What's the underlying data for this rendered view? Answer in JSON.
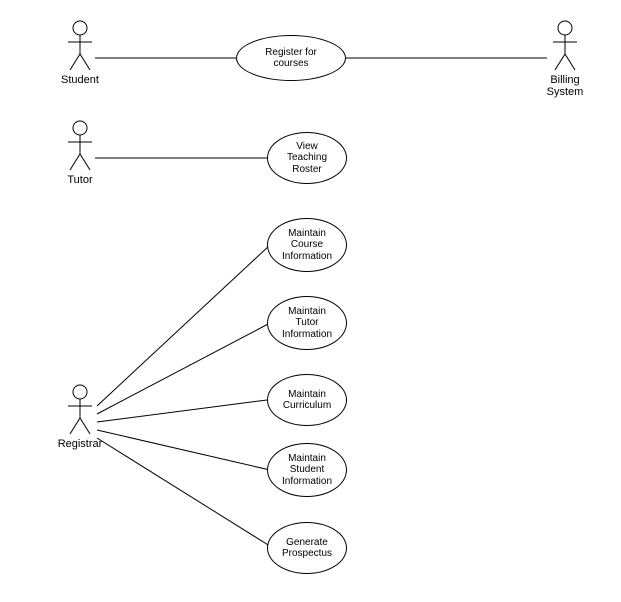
{
  "diagram_type": "UML Use Case Diagram",
  "actors": {
    "student": "Student",
    "billing": "Billing\nSystem",
    "tutor": "Tutor",
    "registrar": "Registrar"
  },
  "usecases": {
    "register": "Register for\ncourses",
    "view_roster": "View\nTeaching\nRoster",
    "maint_course": "Maintain\nCourse\nInformation",
    "maint_tutor": "Maintain\nTutor\nInformation",
    "maint_curriculum": "Maintain\nCurriculum",
    "maint_student": "Maintain\nStudent\nInformation",
    "gen_prospectus": "Generate\nProspectus"
  },
  "associations": [
    [
      "student",
      "register"
    ],
    [
      "billing",
      "register"
    ],
    [
      "tutor",
      "view_roster"
    ],
    [
      "registrar",
      "maint_course"
    ],
    [
      "registrar",
      "maint_tutor"
    ],
    [
      "registrar",
      "maint_curriculum"
    ],
    [
      "registrar",
      "maint_student"
    ],
    [
      "registrar",
      "gen_prospectus"
    ]
  ],
  "chart_data": {
    "type": "use-case-diagram",
    "actors": [
      "Student",
      "Billing System",
      "Tutor",
      "Registrar"
    ],
    "use_cases": [
      "Register for courses",
      "View Teaching Roster",
      "Maintain Course Information",
      "Maintain Tutor Information",
      "Maintain Curriculum",
      "Maintain Student Information",
      "Generate Prospectus"
    ],
    "links": [
      {
        "actor": "Student",
        "use_case": "Register for courses"
      },
      {
        "actor": "Billing System",
        "use_case": "Register for courses"
      },
      {
        "actor": "Tutor",
        "use_case": "View Teaching Roster"
      },
      {
        "actor": "Registrar",
        "use_case": "Maintain Course Information"
      },
      {
        "actor": "Registrar",
        "use_case": "Maintain Tutor Information"
      },
      {
        "actor": "Registrar",
        "use_case": "Maintain Curriculum"
      },
      {
        "actor": "Registrar",
        "use_case": "Maintain Student Information"
      },
      {
        "actor": "Registrar",
        "use_case": "Generate Prospectus"
      }
    ]
  }
}
